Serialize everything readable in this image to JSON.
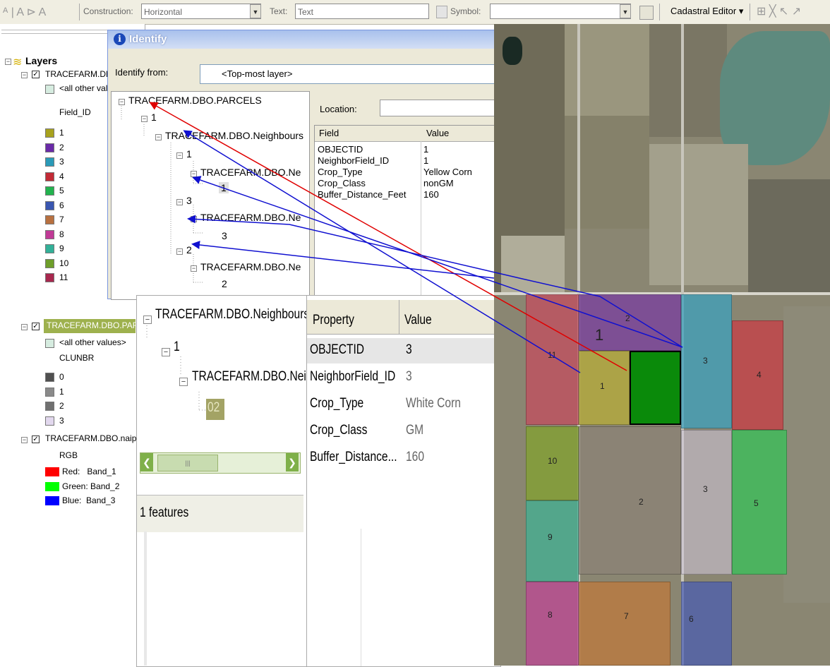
{
  "toolbar": {
    "construction_label": "Construction:",
    "construction_value": "Horizontal",
    "text_label": "Text:",
    "text_value": "Text",
    "symbol_label": "Symbol:",
    "editor_label": "Cadastral Editor"
  },
  "toc": {
    "root_label": "Layers",
    "layer1": {
      "name": "TRACEFARM.DBC",
      "other_values": "<all other valu",
      "field": "Field_ID",
      "classes": [
        {
          "label": "1",
          "color": "#a8a21e"
        },
        {
          "label": "2",
          "color": "#6a2aa8"
        },
        {
          "label": "3",
          "color": "#2a9ab8"
        },
        {
          "label": "4",
          "color": "#c22a36"
        },
        {
          "label": "5",
          "color": "#22b24e"
        },
        {
          "label": "6",
          "color": "#3a56b0"
        },
        {
          "label": "7",
          "color": "#b87040"
        },
        {
          "label": "8",
          "color": "#c03a96"
        },
        {
          "label": "9",
          "color": "#32b098"
        },
        {
          "label": "10",
          "color": "#6e9e2a"
        },
        {
          "label": "11",
          "color": "#a8284e"
        }
      ]
    },
    "layer2": {
      "name": "TRACEFARM.DBO.PARCI",
      "other_values": "<all other values>",
      "field": "CLUNBR",
      "classes": [
        {
          "label": "0",
          "color": "#505050"
        },
        {
          "label": "1",
          "color": "#8a8a8a"
        },
        {
          "label": "2",
          "color": "#707070"
        },
        {
          "label": "3",
          "color": "#e2d8ee"
        }
      ]
    },
    "layer3": {
      "name": "TRACEFARM.DBO.naip_a",
      "field": "RGB",
      "bands": [
        {
          "label": "Red:   Band_1",
          "color": "#ff0000"
        },
        {
          "label": "Green: Band_2",
          "color": "#00ff00"
        },
        {
          "label": "Blue:  Band_3",
          "color": "#0000ff"
        }
      ]
    }
  },
  "identify": {
    "title": "Identify",
    "from_label": "Identify from:",
    "from_value": "<Top-most layer>",
    "location_label": "Location:",
    "tree": [
      "TRACEFARM.DBO.PARCELS",
      "1",
      "TRACEFARM.DBO.Neighbours",
      "1",
      "TRACEFARM.DBO.Ne",
      "1",
      "3",
      "TRACEFARM.DBO.Ne",
      "3",
      "2",
      "TRACEFARM.DBO.Ne",
      "2"
    ],
    "grid_headers": [
      "Field",
      "Value"
    ],
    "grid_rows": [
      [
        "OBJECTID",
        "1"
      ],
      [
        "NeighborField_ID",
        "1"
      ],
      [
        "Crop_Type",
        "Yellow Corn"
      ],
      [
        "Crop_Class",
        "nonGM"
      ],
      [
        "Buffer_Distance_Feet",
        "160"
      ]
    ]
  },
  "zoom": {
    "tree": [
      "TRACEFARM.DBO.Neighbours",
      "1",
      "TRACEFARM.DBO.Neig",
      "02"
    ],
    "status": "1 features",
    "grid_headers": [
      "Property",
      "Value"
    ],
    "grid_rows": [
      [
        "OBJECTID",
        "3"
      ],
      [
        "NeighborField_ID",
        "3"
      ],
      [
        "Crop_Type",
        "White Corn"
      ],
      [
        "Crop_Class",
        "GM"
      ],
      [
        "Buffer_Distance...",
        "160"
      ]
    ]
  },
  "map": {
    "labels": {
      "p2": "2",
      "p1big": "1",
      "p11": "11",
      "p1": "1",
      "p3a": "3",
      "p4": "4",
      "p10": "10",
      "p2b": "2",
      "p3b": "3",
      "p5": "5",
      "p9": "9",
      "p8": "8",
      "p7": "7",
      "p6": "6"
    },
    "selected_color": "#0a8a0a"
  }
}
